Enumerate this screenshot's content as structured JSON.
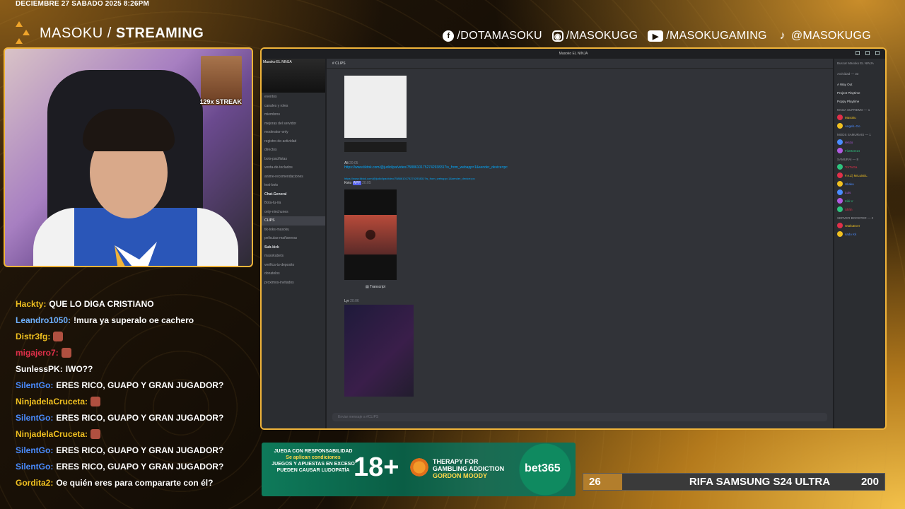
{
  "header": {
    "datetime": "DECIEMBRE 27 SABADO 2025 8:26PM",
    "brand_light": "MASOKU / ",
    "brand_bold": "STREAMING"
  },
  "socials": [
    {
      "icon": "facebook-icon",
      "label": "/DOTAMASOKU"
    },
    {
      "icon": "instagram-icon",
      "label": "/MASOKUGG"
    },
    {
      "icon": "youtube-icon",
      "label": "/MASOKUGAMING"
    },
    {
      "icon": "tiktok-icon",
      "label": "@MASOKUGG"
    }
  ],
  "webcam": {
    "streak_label": "129x STREAK"
  },
  "chat": [
    {
      "user": "Hackty:",
      "user_color": "#f0c020",
      "msg": "QUE LO DIGA CRISTIANO"
    },
    {
      "user": "Leandro1050:",
      "user_color": "#6fb1ff",
      "msg": "!mura ya superalo oe cachero"
    },
    {
      "user": "Distr3fg:",
      "user_color": "#f0c020",
      "msg": ""
    },
    {
      "user": "migajero7:",
      "user_color": "#e0304a",
      "msg": ""
    },
    {
      "user": "SunlessPK:",
      "user_color": "#ffffff",
      "msg": "IWO??"
    },
    {
      "user": "SilentGo:",
      "user_color": "#4a8cff",
      "msg": "ERES RICO, GUAPO Y GRAN JUGADOR?"
    },
    {
      "user": "NinjadelaCruceta:",
      "user_color": "#f0c020",
      "msg": ""
    },
    {
      "user": "SilentGo:",
      "user_color": "#4a8cff",
      "msg": "ERES RICO, GUAPO Y GRAN JUGADOR?"
    },
    {
      "user": "NinjadelaCruceta:",
      "user_color": "#f0c020",
      "msg": ""
    },
    {
      "user": "SilentGo:",
      "user_color": "#4a8cff",
      "msg": "ERES RICO, GUAPO Y GRAN JUGADOR?"
    },
    {
      "user": "SilentGo:",
      "user_color": "#4a8cff",
      "msg": "ERES RICO, GUAPO Y GRAN JUGADOR?"
    },
    {
      "user": "Gordita2:",
      "user_color": "#f0c020",
      "msg": "Oe quién eres para compararte con él?"
    }
  ],
  "discord": {
    "window_title": "Masoko EL NINJA",
    "server_name": "Masoko EL NINJA",
    "channel_header": "CLIPS",
    "search_placeholder": "Buscar Masoko EL NINJA",
    "channels": [
      "eventos",
      "canales y roles",
      "miembros",
      "mejoras del servidor",
      "moderator-only",
      "registro-de-actividad",
      "directos",
      "bots-pacifistas",
      "venta-de-teclados",
      "anime-recomendaciones",
      "test-bots",
      "Chat-General",
      "Bota-tu-ira",
      "only-ninchunes",
      "CLIPS",
      "tik-toks-masoku",
      "peliculas-mañaneras",
      "Sub-kick",
      "masokubets",
      "verifica-tu-deposito",
      "donatelos",
      "proximos-invitados"
    ],
    "messages": [
      {
        "author": "Ali",
        "time": "20:05",
        "link": "https://www.tiktok.com/@judicilpa/video/7588610175274293831?is_from_webapp=1&sender_device=pc"
      },
      {
        "author": "Keto",
        "time": "20:05",
        "tag": "APP",
        "link": "https://www.tiktok.com/@judicilpa/video/7588610175274293831?is_from_webapp=1&sender_device=pc"
      },
      {
        "author": "Lyr",
        "time": "20:06",
        "link": ""
      }
    ],
    "transcript_label": "Transcript",
    "input_placeholder": "Enviar mensaje a #CLIPS",
    "members_header": "Actividad — 33",
    "activity": [
      "A Way Out",
      "Project Playtime",
      "Poppy Playtime"
    ],
    "roles": [
      "NINJA SUPREMO — 1",
      "MODS SAMURAIS — 1",
      "SAMURAI — 8",
      "SERVER BOOSTER — 2"
    ],
    "members": [
      "Masoku",
      "AngelL-Go",
      "renzo",
      "FioMoO14",
      "TorTuGa",
      "F.e.Z) MrLuisEL",
      "Ukaku",
      "Luis",
      "Kiki.V",
      "Shhh",
      "OtakuEver",
      "sado Kk"
    ]
  },
  "ad": {
    "responsible_title": "JUEGA CON RESPONSABILIDAD",
    "responsible_sub": "Se aplican condiciones",
    "warning": "JUEGOS Y APUESTAS EN EXCESO PUEDEN CAUSAR LUDOPATÍA",
    "age": "18+",
    "therapy_l1": "THERAPY FOR",
    "therapy_l2": "GAMBLING ADDICTION",
    "therapy_l3": "GORDON MOODY",
    "brand": "bet365"
  },
  "raffle": {
    "current": "26",
    "title": "RIFA SAMSUNG S24 ULTRA",
    "goal": "200",
    "progress": 0.13,
    "fill_color": "#c98b2a"
  },
  "colors": {
    "accent_gold": "#f0b43a",
    "discord_bg": "#313338"
  }
}
